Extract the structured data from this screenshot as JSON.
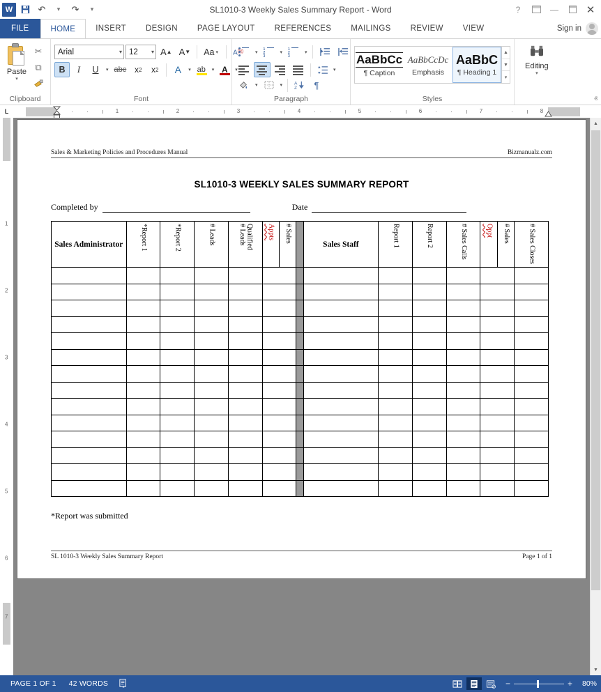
{
  "titlebar": {
    "app_icon": "word-logo",
    "title": "SL1010-3 Weekly Sales Summary Report - Word",
    "quick_access": [
      {
        "name": "save",
        "icon": "save-icon",
        "glyph": "⬛"
      },
      {
        "name": "undo",
        "icon": "undo-icon",
        "glyph": "↶"
      },
      {
        "name": "redo",
        "icon": "redo-icon",
        "glyph": "↻"
      },
      {
        "name": "customize",
        "icon": "chevron-down-icon",
        "glyph": "▾"
      }
    ],
    "window_controls": [
      {
        "name": "help",
        "glyph": "?"
      },
      {
        "name": "ribbon-display-options",
        "glyph": "⬚"
      },
      {
        "name": "minimize",
        "glyph": "—"
      },
      {
        "name": "restore",
        "glyph": "❐"
      },
      {
        "name": "close",
        "glyph": "✕"
      }
    ]
  },
  "tabs": {
    "file": "FILE",
    "items": [
      "HOME",
      "INSERT",
      "DESIGN",
      "PAGE LAYOUT",
      "REFERENCES",
      "MAILINGS",
      "REVIEW",
      "VIEW"
    ],
    "active": "HOME",
    "signin": "Sign in"
  },
  "ribbon": {
    "clipboard": {
      "label": "Clipboard",
      "paste": "Paste",
      "cut": "✂",
      "copy": "⧉",
      "format_painter": "🖌",
      "launcher": "⬎"
    },
    "font": {
      "label": "Font",
      "font_name": "Arial",
      "font_size": "12",
      "grow": "A",
      "shrink": "A",
      "change_case": "Aa",
      "clear_formatting": "A",
      "bold": "B",
      "italic": "I",
      "underline": "U",
      "strikethrough": "abc",
      "subscript": "x",
      "superscript": "x",
      "text_effects": "A",
      "highlight": "ab",
      "font_color": "A",
      "launcher": "⬎",
      "bold_active": true
    },
    "paragraph": {
      "label": "Paragraph",
      "launcher": "⬎",
      "center_active": true
    },
    "styles": {
      "label": "Styles",
      "launcher": "⬎",
      "items": [
        {
          "preview": "AaBbCc",
          "name": "¶ Caption",
          "selected": false
        },
        {
          "preview": "AaBbCcDc",
          "name": "Emphasis",
          "selected": false
        },
        {
          "preview": "AaBbC",
          "name": "¶ Heading 1",
          "selected": true
        }
      ]
    },
    "editing": {
      "label": "Editing",
      "icon": "binoculars-icon",
      "glyph": "🔎"
    },
    "collapse": "ⱏ"
  },
  "ruler": {
    "corner_label": "L",
    "h_ticks": [
      "1",
      "2",
      "3",
      "4",
      "5",
      "6",
      "7",
      "8"
    ],
    "v_ticks": [
      "1",
      "2",
      "3",
      "4",
      "5",
      "6",
      "7"
    ]
  },
  "document": {
    "header_left": "Sales & Marketing Policies and Procedures Manual",
    "header_right": "Bizmanualz.com",
    "title": "SL1010-3 WEEKLY SALES SUMMARY REPORT",
    "completed_by_label": "Completed by",
    "date_label": "Date",
    "footnote": "*Report was submitted",
    "footer_left": "SL 1010-3 Weekly Sales Summary Report",
    "footer_right": "Page 1 of 1",
    "table": {
      "left_headers": [
        {
          "text": "Sales Administrator",
          "orientation": "horizontal",
          "spellerror": false
        },
        {
          "text": "*Report 1",
          "orientation": "vertical",
          "spellerror": false
        },
        {
          "text": "*Report 2",
          "orientation": "vertical",
          "spellerror": false
        },
        {
          "text": "# Leads",
          "orientation": "vertical",
          "spellerror": false
        },
        {
          "text": "Qualified\n# Leads",
          "orientation": "vertical",
          "spellerror": false
        },
        {
          "text": "Appts",
          "orientation": "vertical",
          "spellerror": true
        },
        {
          "text": "# Sales",
          "orientation": "vertical",
          "spellerror": false
        }
      ],
      "right_headers": [
        {
          "text": "Sales Staff",
          "orientation": "horizontal",
          "spellerror": false
        },
        {
          "text": "Report 1",
          "orientation": "vertical",
          "spellerror": false
        },
        {
          "text": "Report 2",
          "orientation": "vertical",
          "spellerror": false
        },
        {
          "text": "# Sales Calls",
          "orientation": "vertical",
          "spellerror": false
        },
        {
          "text": "Oppt",
          "orientation": "vertical",
          "spellerror": true
        },
        {
          "text": "# Sales",
          "orientation": "vertical",
          "spellerror": false
        },
        {
          "text": "# Sales Closes",
          "orientation": "vertical",
          "spellerror": false
        }
      ],
      "body_row_count": 14,
      "divider_color": "#9a9a9a"
    }
  },
  "statusbar": {
    "page_info": "PAGE 1 OF 1",
    "word_count": "42 WORDS",
    "proofing_icon": "proofing-errors-icon",
    "views": [
      {
        "name": "read-mode",
        "glyph": "▤",
        "selected": false
      },
      {
        "name": "print-layout",
        "glyph": "▥",
        "selected": true
      },
      {
        "name": "web-layout",
        "glyph": "▦",
        "selected": false
      }
    ],
    "zoom_out": "−",
    "zoom_in": "+",
    "zoom_level": "80%"
  }
}
